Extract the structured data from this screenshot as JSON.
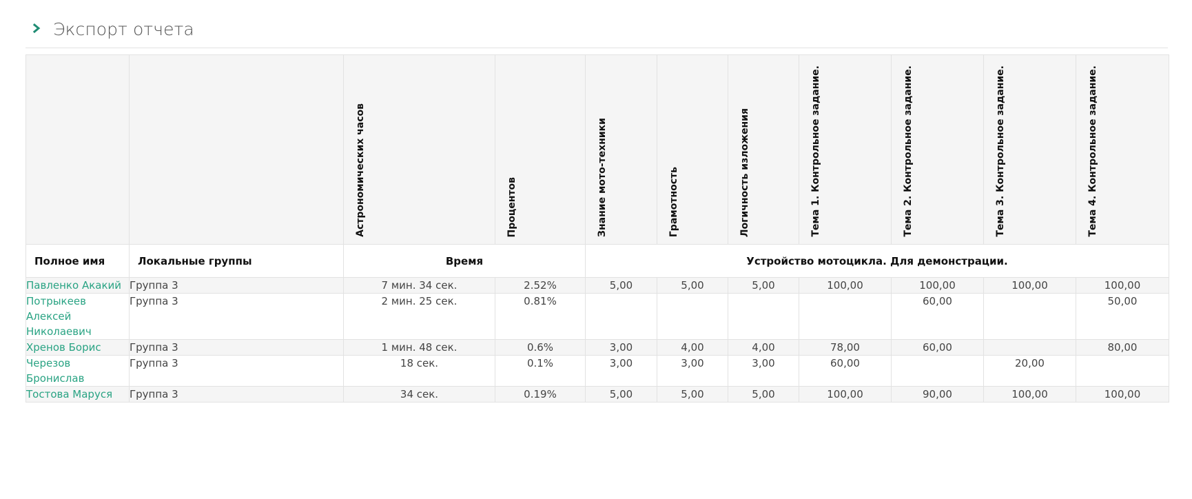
{
  "header": {
    "title": "Экспорт отчета"
  },
  "columns": {
    "full_name": "Полное имя",
    "local_groups": "Локальные группы",
    "time_group": "Время",
    "course_group": "Устройство мотоцикла. Для демонстрации.",
    "rotated": [
      "Астрономических часов",
      "Процентов",
      "Знание мото-техники",
      "Грамотность",
      "Логичность изложения",
      "Тема 1. Контрольное задание.",
      "Тема 2. Контрольное задание.",
      "Тема 3. Контрольное задание.",
      "Тема 4. Контрольное задание."
    ]
  },
  "rows": [
    {
      "name": "Павленко Акакий",
      "group": "Группа 3",
      "hours": "7 мин. 34 сек.",
      "percent": "2.52%",
      "c1": "5,00",
      "c2": "5,00",
      "c3": "5,00",
      "t1": "100,00",
      "t2": "100,00",
      "t3": "100,00",
      "t4": "100,00"
    },
    {
      "name": "Потрыкеев Алексей Николаевич",
      "group": "Группа 3",
      "hours": "2 мин. 25 сек.",
      "percent": "0.81%",
      "c1": "",
      "c2": "",
      "c3": "",
      "t1": "",
      "t2": "60,00",
      "t3": "",
      "t4": "50,00"
    },
    {
      "name": "Хренов Борис",
      "group": "Группа 3",
      "hours": "1 мин. 48 сек.",
      "percent": "0.6%",
      "c1": "3,00",
      "c2": "4,00",
      "c3": "4,00",
      "t1": "78,00",
      "t2": "60,00",
      "t3": "",
      "t4": "80,00"
    },
    {
      "name": "Черезов Бронислав",
      "group": "Группа 3",
      "hours": "18 сек.",
      "percent": "0.1%",
      "c1": "3,00",
      "c2": "3,00",
      "c3": "3,00",
      "t1": "60,00",
      "t2": "",
      "t3": "20,00",
      "t4": ""
    },
    {
      "name": "Тостова Маруся",
      "group": "Группа 3",
      "hours": "34 сек.",
      "percent": "0.19%",
      "c1": "5,00",
      "c2": "5,00",
      "c3": "5,00",
      "t1": "100,00",
      "t2": "90,00",
      "t3": "100,00",
      "t4": "100,00"
    }
  ],
  "colors": {
    "accent": "#29a383",
    "header_bg": "#f5f5f5",
    "border": "#e2e2e2"
  },
  "icons": {
    "header_toggle": "chevron-right-icon"
  }
}
